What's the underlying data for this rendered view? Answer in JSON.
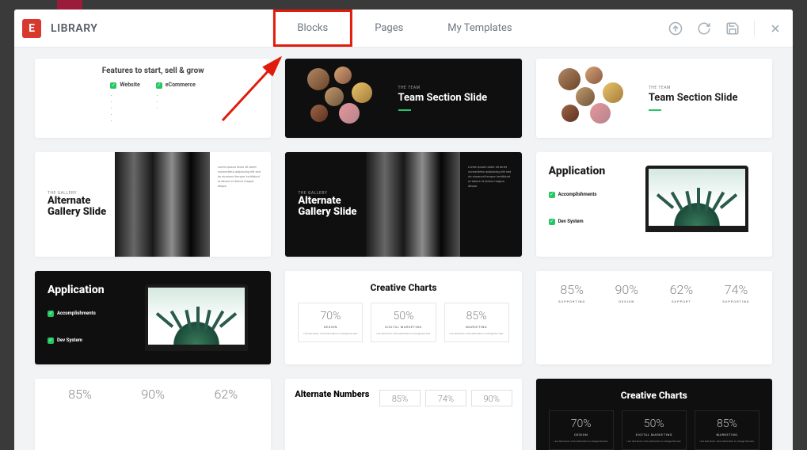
{
  "header": {
    "title": "LIBRARY",
    "tabs": {
      "blocks": "Blocks",
      "pages": "Pages",
      "my_templates": "My Templates"
    }
  },
  "templates": {
    "features": {
      "heading": "Features to start, sell & grow",
      "col1_label": "Website",
      "col2_label": "eCommerce"
    },
    "team_dark": {
      "overline": "THE TEAM",
      "title": "Team Section Slide"
    },
    "team_light": {
      "overline": "THE TEAM",
      "title": "Team Section Slide"
    },
    "gallery_light": {
      "overline": "THE GALLERY",
      "title": "Alternate Gallery Slide"
    },
    "gallery_dark": {
      "overline": "THE GALLERY",
      "title": "Alternate Gallery Slide"
    },
    "app_light": {
      "title": "Application",
      "chk1": "Accomplishments",
      "chk2": "Dev System"
    },
    "app_dark": {
      "title": "Application",
      "chk1": "Accomplishments",
      "chk2": "Dev System"
    },
    "cc_light": {
      "title": "Creative Charts",
      "cells": [
        {
          "pct": "70%",
          "lbl": "DESIGN"
        },
        {
          "pct": "50%",
          "lbl": "DIGITAL MARKETING"
        },
        {
          "pct": "85%",
          "lbl": "MARKETING"
        }
      ]
    },
    "cc_dark": {
      "title": "Creative Charts",
      "cells": [
        {
          "pct": "70%",
          "lbl": "DESIGN"
        },
        {
          "pct": "50%",
          "lbl": "DIGITAL MARKETING"
        },
        {
          "pct": "85%",
          "lbl": "MARKETING"
        }
      ]
    },
    "pcts_light": [
      {
        "v": "85%",
        "l": "SUPPORTING"
      },
      {
        "v": "90%",
        "l": "DESIGN"
      },
      {
        "v": "62%",
        "l": "SUPPORT"
      },
      {
        "v": "74%",
        "l": "SUPPORTING"
      }
    ],
    "pcts_cut": [
      {
        "v": "85%",
        "l": ""
      },
      {
        "v": "90%",
        "l": ""
      },
      {
        "v": "62%",
        "l": ""
      }
    ],
    "altnum": {
      "title": "Alternate Numbers",
      "cells": [
        {
          "v": "85%",
          "l": ""
        },
        {
          "v": "74%",
          "l": ""
        },
        {
          "v": "90%",
          "l": ""
        }
      ]
    }
  }
}
